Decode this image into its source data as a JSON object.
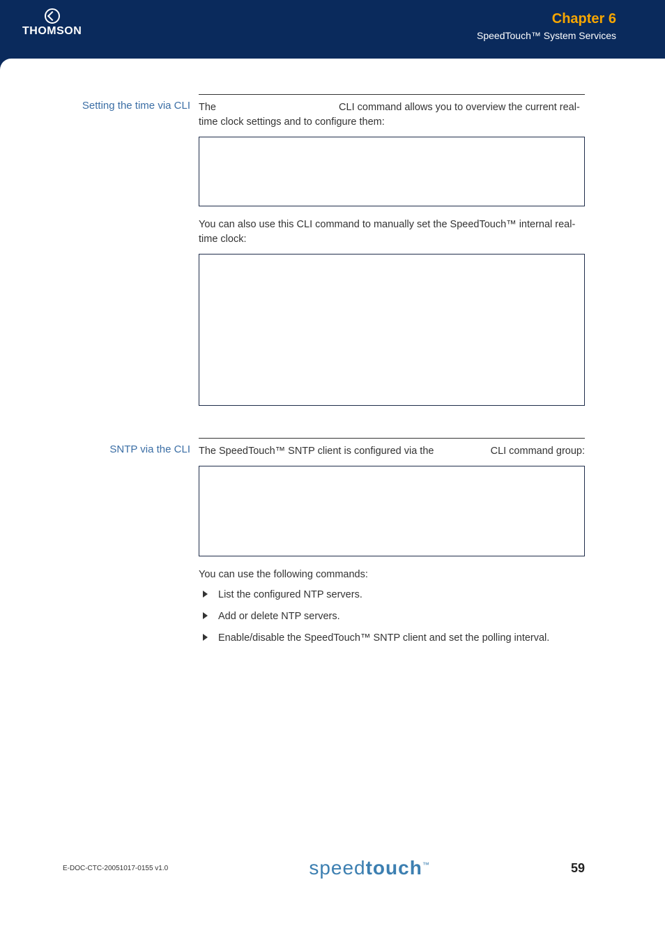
{
  "header": {
    "brand_logo_text": "THOMSON",
    "chapter_label": "Chapter 6",
    "subtitle": "SpeedTouch™ System Services"
  },
  "sections": {
    "set_time": {
      "title": "Setting the time via CLI",
      "p1_pre": "The ",
      "p1_post": " CLI command allows you to overview the current real-time clock settings and to configure them:",
      "p2": "You can also use this CLI command to manually set the SpeedTouch™ internal real-time clock:"
    },
    "sntp": {
      "title": "SNTP via the CLI",
      "p1_pre": "The SpeedTouch™ SNTP client is configured via the ",
      "p1_post": " CLI command group:",
      "list_intro": "You can use the following commands:",
      "items": [
        {
          "cmd": "",
          "desc": "List the configured NTP servers."
        },
        {
          "cmd": "",
          "desc": "Add or delete NTP servers."
        },
        {
          "cmd": "",
          "desc": "Enable/disable the SpeedTouch™ SNTP client and set the polling interval."
        }
      ]
    }
  },
  "footer": {
    "doc_id": "E-DOC-CTC-20051017-0155 v1.0",
    "brand_thin": "speed",
    "brand_bold": "touch",
    "brand_tm": "™",
    "page_number": "59"
  }
}
